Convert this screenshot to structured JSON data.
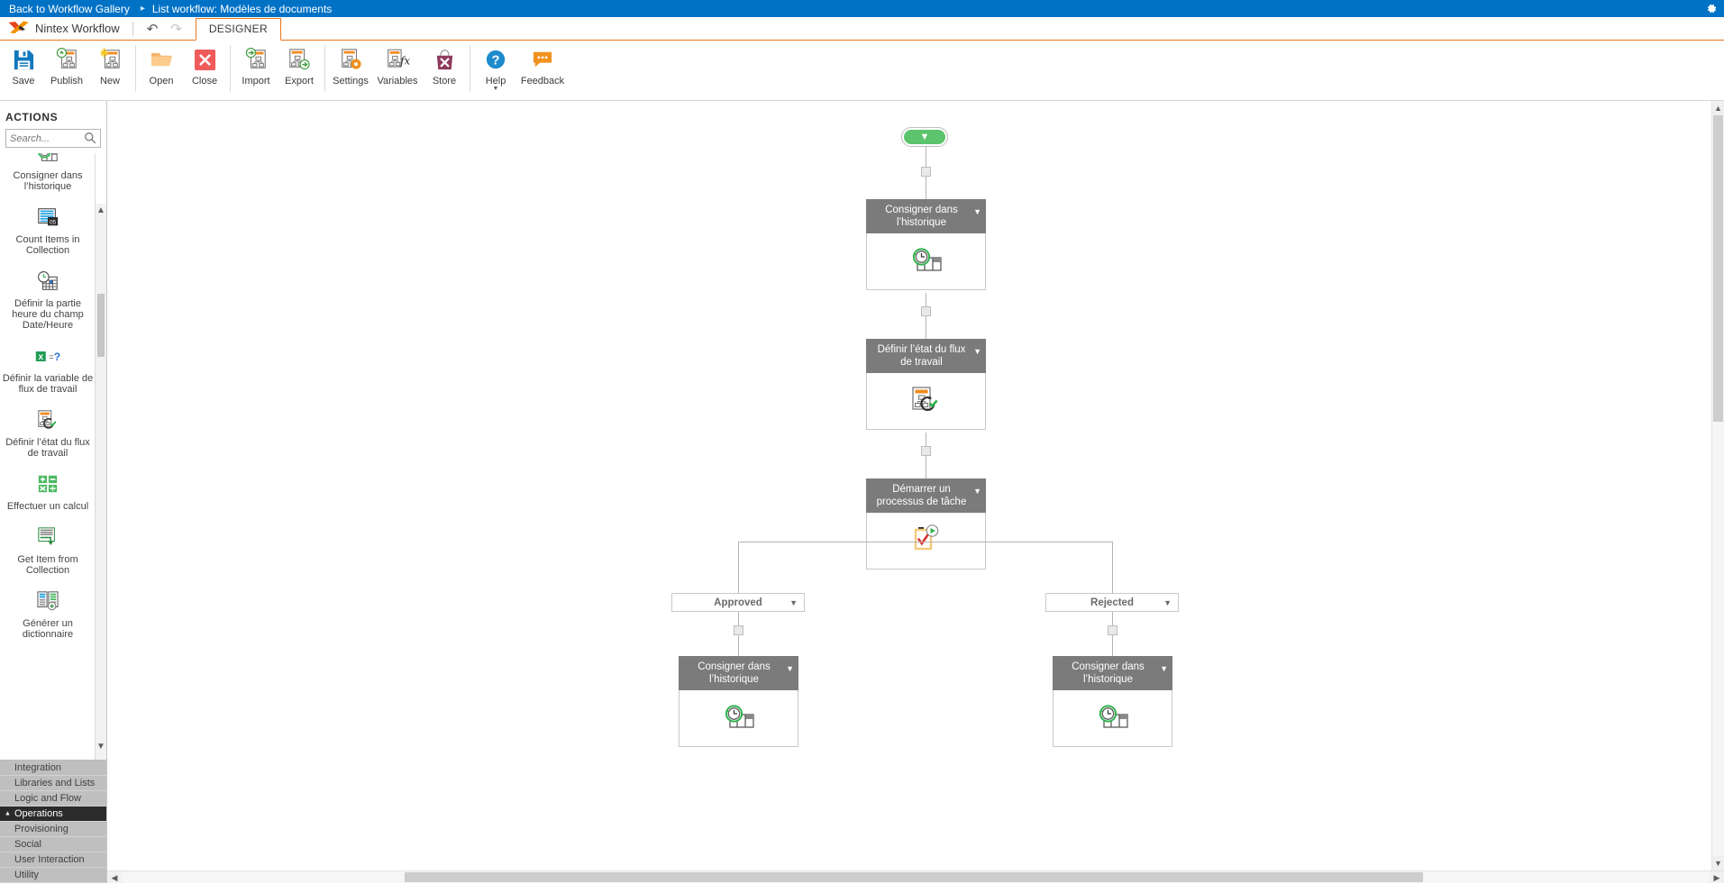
{
  "topbar": {
    "back_link": "Back to Workflow Gallery",
    "separator": "▸",
    "current": "List workflow: Modèles de documents",
    "settings_icon": "gear-icon"
  },
  "ribbon": {
    "brand": "Nintex Workflow",
    "undo_icon": "↶",
    "redo_icon": "↷",
    "tabs": [
      {
        "label": "DESIGNER",
        "active": true
      }
    ],
    "buttons": [
      {
        "label": "Save",
        "icon": "save-icon"
      },
      {
        "label": "Publish",
        "icon": "publish-icon"
      },
      {
        "label": "New",
        "icon": "new-icon"
      },
      {
        "label": "Open",
        "icon": "open-folder-icon"
      },
      {
        "label": "Close",
        "icon": "close-x-icon"
      },
      {
        "label": "Import",
        "icon": "import-icon"
      },
      {
        "label": "Export",
        "icon": "export-icon"
      },
      {
        "label": "Settings",
        "icon": "settings-gear-icon"
      },
      {
        "label": "Variables",
        "icon": "variables-fx-icon"
      },
      {
        "label": "Store",
        "icon": "store-bag-icon"
      },
      {
        "label": "Help",
        "icon": "help-question-icon"
      },
      {
        "label": "Feedback",
        "icon": "feedback-bubble-icon"
      }
    ]
  },
  "sidebar": {
    "title": "ACTIONS",
    "search": {
      "value": "",
      "placeholder": "Search...",
      "icon": "search-icon"
    },
    "actions": [
      {
        "label": "Consigner dans l’historique",
        "icon": "history-clock-icon"
      },
      {
        "label": "Count Items in Collection",
        "icon": "count-items-icon"
      },
      {
        "label": "Définir la partie heure du champ Date/Heure",
        "icon": "date-time-icon"
      },
      {
        "label": "Définir la variable de flux de travail",
        "icon": "set-variable-icon"
      },
      {
        "label": "Définir l’état du flux de travail",
        "icon": "set-state-icon"
      },
      {
        "label": "Effectuer un calcul",
        "icon": "calculator-icon"
      },
      {
        "label": "Get Item from Collection",
        "icon": "get-item-icon"
      },
      {
        "label": "Générer un dictionnaire",
        "icon": "build-dictionary-icon"
      }
    ],
    "categories": [
      {
        "label": "Integration",
        "selected": false
      },
      {
        "label": "Libraries and Lists",
        "selected": false
      },
      {
        "label": "Logic and Flow",
        "selected": false
      },
      {
        "label": "Operations",
        "selected": true
      },
      {
        "label": "Provisioning",
        "selected": false
      },
      {
        "label": "Social",
        "selected": false
      },
      {
        "label": "User Interaction",
        "selected": false
      },
      {
        "label": "Utility",
        "selected": false
      }
    ]
  },
  "canvas": {
    "start_label": "start-node",
    "nodes": [
      {
        "title": "Consigner dans l’historique",
        "icon": "history-clock-icon"
      },
      {
        "title": "Définir l’état du flux de travail",
        "icon": "set-state-icon"
      },
      {
        "title": "Démarrer un processus de tâche",
        "icon": "start-task-process-icon"
      },
      {
        "title": "Consigner dans l’historique",
        "icon": "history-clock-icon"
      },
      {
        "title": "Consigner dans l’historique",
        "icon": "history-clock-icon"
      }
    ],
    "branches": [
      {
        "label": "Approved"
      },
      {
        "label": "Rejected"
      }
    ]
  },
  "colors": {
    "topbar_blue": "#0072c6",
    "accent_orange": "#e8761c",
    "node_header_gray": "#7b7b7b",
    "start_green": "#5cc46c",
    "category_gray": "#bfbfbf",
    "category_selected": "#2b2b2b"
  }
}
